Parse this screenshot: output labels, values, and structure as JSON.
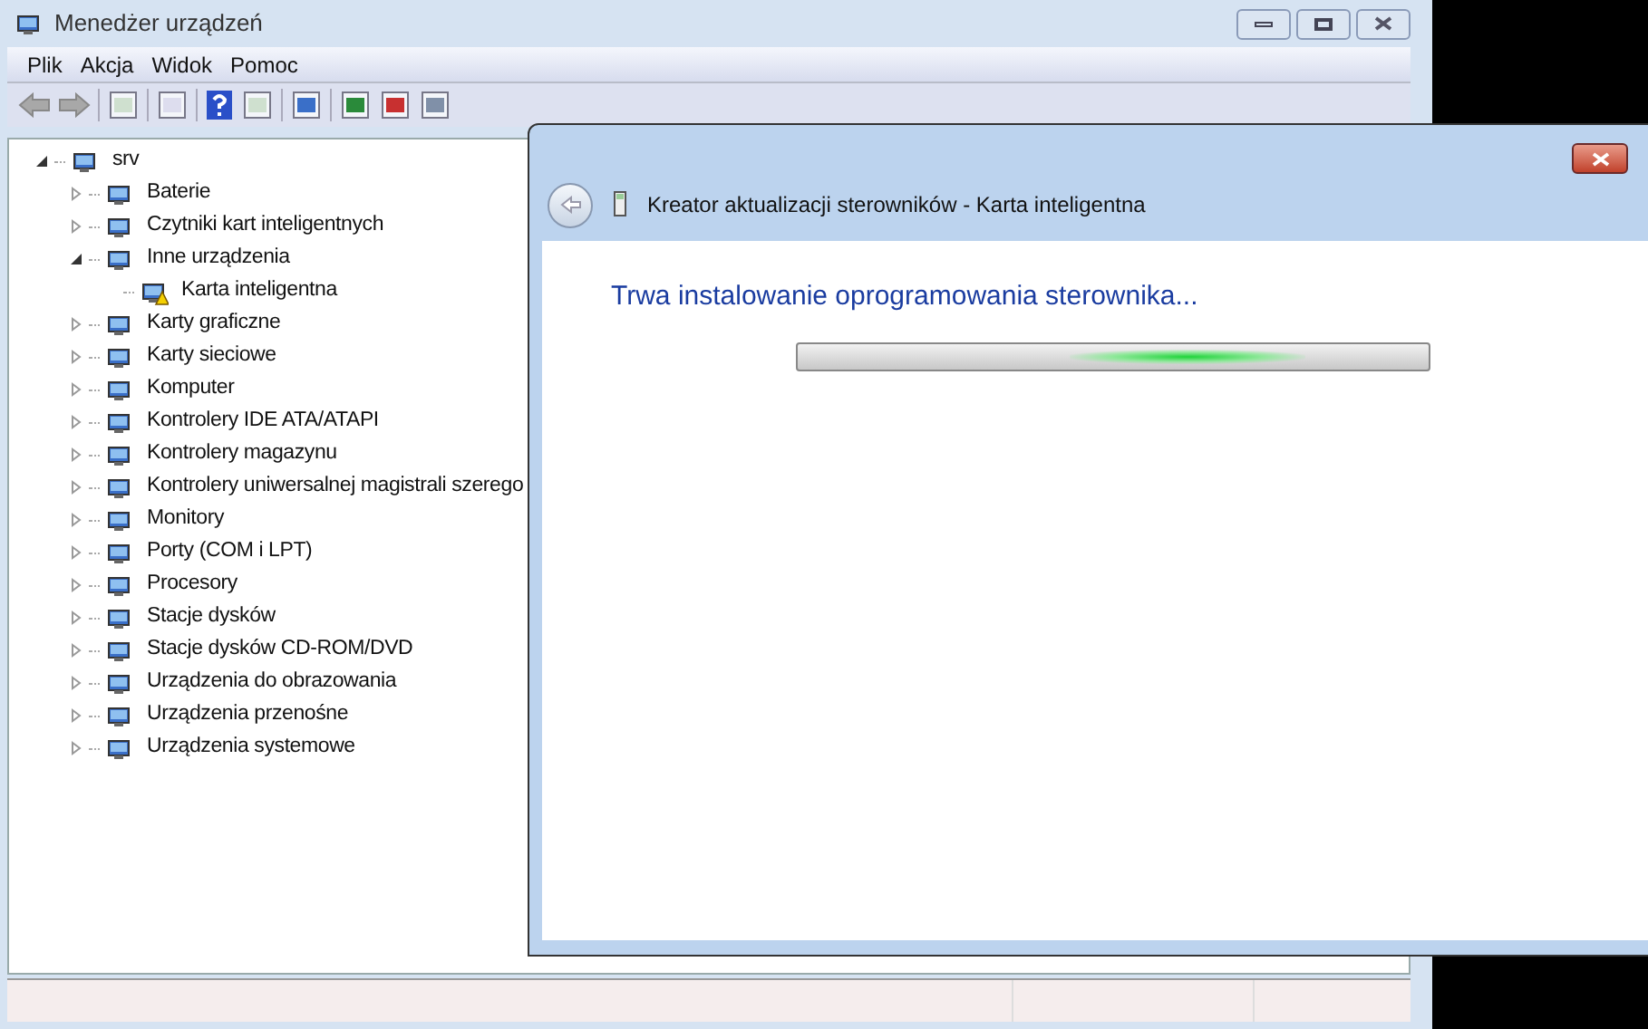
{
  "main_window": {
    "title": "Menedżer urządzeń",
    "menu": [
      "Plik",
      "Akcja",
      "Widok",
      "Pomoc"
    ],
    "tree": {
      "label": "srv",
      "expanded": true,
      "warning": false,
      "children": [
        {
          "label": "Baterie",
          "expanded": false,
          "warning": false
        },
        {
          "label": "Czytniki kart inteligentnych",
          "expanded": false,
          "warning": false
        },
        {
          "label": "Inne urządzenia",
          "expanded": true,
          "warning": false,
          "children": [
            {
              "label": "Karta inteligentna",
              "warning": true
            }
          ]
        },
        {
          "label": "Karty graficzne",
          "expanded": false,
          "warning": false
        },
        {
          "label": "Karty sieciowe",
          "expanded": false,
          "warning": false
        },
        {
          "label": "Komputer",
          "expanded": false,
          "warning": false
        },
        {
          "label": "Kontrolery IDE ATA/ATAPI",
          "expanded": false,
          "warning": false
        },
        {
          "label": "Kontrolery magazynu",
          "expanded": false,
          "warning": false
        },
        {
          "label": "Kontrolery uniwersalnej magistrali szerego",
          "expanded": false,
          "warning": false
        },
        {
          "label": "Monitory",
          "expanded": false,
          "warning": false
        },
        {
          "label": "Porty (COM i LPT)",
          "expanded": false,
          "warning": false
        },
        {
          "label": "Procesory",
          "expanded": false,
          "warning": false
        },
        {
          "label": "Stacje dysków",
          "expanded": false,
          "warning": false
        },
        {
          "label": "Stacje dysków CD-ROM/DVD",
          "expanded": false,
          "warning": false
        },
        {
          "label": "Urządzenia do obrazowania",
          "expanded": false,
          "warning": false
        },
        {
          "label": "Urządzenia przenośne",
          "expanded": false,
          "warning": false
        },
        {
          "label": "Urządzenia systemowe",
          "expanded": false,
          "warning": false
        }
      ]
    }
  },
  "dialog": {
    "title": "Kreator aktualizacji sterowników - Karta inteligentna",
    "heading": "Trwa instalowanie oprogramowania sterownika..."
  }
}
